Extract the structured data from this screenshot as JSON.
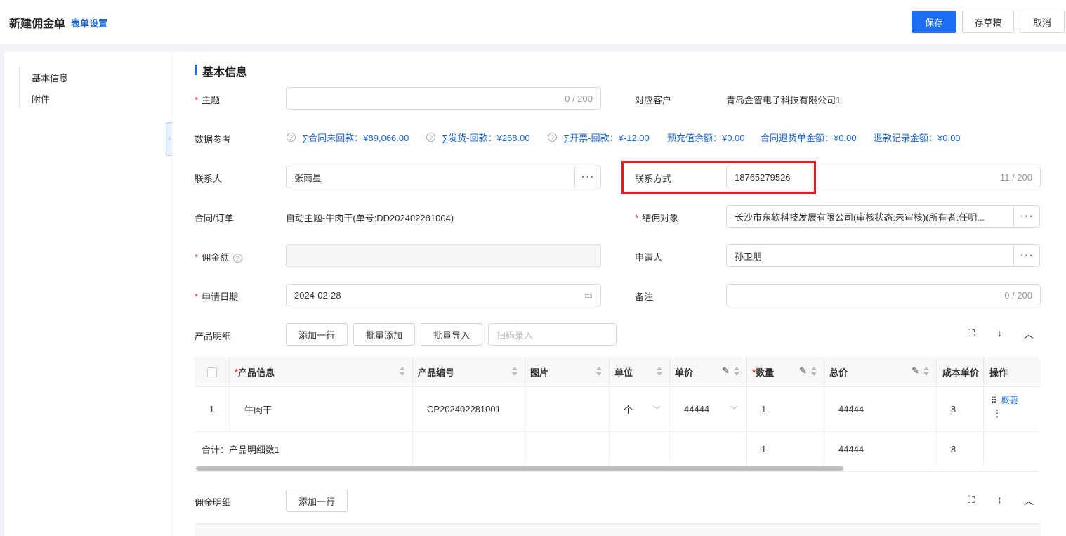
{
  "header": {
    "title": "新建佣金单",
    "form_settings": "表单设置",
    "save": "保存",
    "draft": "存草稿",
    "cancel": "取消"
  },
  "nav": {
    "items": [
      "基本信息",
      "附件"
    ]
  },
  "section": {
    "title": "基本信息"
  },
  "fields": {
    "subject": {
      "label": "主题",
      "counter": "0 / 200"
    },
    "customer": {
      "label": "对应客户",
      "value": "青岛金智电子科技有限公司1"
    },
    "data_ref": {
      "label": "数据参考",
      "items": [
        "∑合同未回款：¥89,066.00",
        "∑发货-回款：¥268.00",
        "∑开票-回款：¥-12.00",
        "预充值余额：¥0.00",
        "合同退货单金额：¥0.00",
        "退款记录金额：¥0.00"
      ]
    },
    "contact": {
      "label": "联系人",
      "value": "张南星"
    },
    "contact_method": {
      "label": "联系方式",
      "value": "18765279526",
      "counter": "11 / 200"
    },
    "contract": {
      "label": "合同/订单",
      "value": "自动主题-牛肉干(单号:DD202402281004)"
    },
    "settle_target": {
      "label": "结佣对象",
      "value": "长沙市东软科技发展有限公司(审核状态:未审核)(所有者:任明..."
    },
    "commission": {
      "label": "佣金额"
    },
    "applicant": {
      "label": "申请人",
      "value": "孙卫朋"
    },
    "apply_date": {
      "label": "申请日期",
      "value": "2024-02-28"
    },
    "remark": {
      "label": "备注",
      "counter": "0 / 200"
    }
  },
  "product_detail": {
    "label": "产品明细",
    "add_row": "添加一行",
    "batch_add": "批量添加",
    "batch_import": "批量导入",
    "scan_placeholder": "扫码录入",
    "columns": [
      "产品信息",
      "产品编号",
      "图片",
      "单位",
      "单价",
      "数量",
      "总价",
      "成本单价",
      "操作"
    ],
    "row": {
      "index": "1",
      "name": "牛肉干",
      "code": "CP202402281001",
      "unit": "个",
      "price": "44444",
      "qty": "1",
      "total": "44444",
      "cost": "8",
      "action": "概要"
    },
    "summary": {
      "label": "合计：产品明细数1",
      "qty": "1",
      "total": "44444",
      "cost": "8"
    }
  },
  "commission_detail": {
    "label": "佣金明细",
    "add_row": "添加一行"
  }
}
